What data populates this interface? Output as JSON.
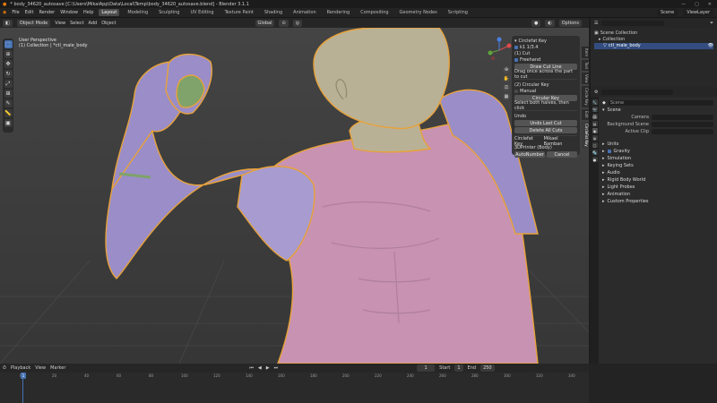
{
  "window": {
    "title": "* body_34620_autosave [C:\\Users\\MikaiApp\\Data\\Local\\Temp\\body_34620_autosave.blend] - Blender 3.1.1",
    "min": "—",
    "max": "▢",
    "close": "✕"
  },
  "menus": [
    "File",
    "Edit",
    "Render",
    "Window",
    "Help"
  ],
  "workspaces": [
    "Layout",
    "Modeling",
    "Sculpting",
    "UV Editing",
    "Texture Paint",
    "Shading",
    "Animation",
    "Rendering",
    "Compositing",
    "Geometry Nodes",
    "Scripting"
  ],
  "active_workspace": "Layout",
  "scene": {
    "label": "Scene",
    "view_layer": "ViewLayer"
  },
  "viewport_header": {
    "mode": "Object Mode",
    "menus": [
      "View",
      "Select",
      "Add",
      "Object"
    ],
    "orientation": "Global",
    "options": "Options"
  },
  "viewport_info": {
    "line1": "User Perspective",
    "line2": "(1) Collection | *ctl_male_body"
  },
  "npanel": {
    "title": "Circlefat Key",
    "k1": "k1 1/3.4",
    "cut_label": "(1) Cut",
    "freehand": "Freehand",
    "draw_btn": "Draw Cut Line",
    "draw_hint": "Drag once across the part to cut",
    "circular_label": "(2) Circular Key",
    "manual": "Manual",
    "circular_btn": "Circular Key",
    "circular_hint": "Select both halves, then click",
    "undo_label": "Undo",
    "undo_btn": "Undo Last Cut",
    "delete_btn": "Delete All Cuts",
    "k2_left": "Circlefat Key",
    "k2_right": "Mikael Bamban",
    "printer": "3DPrinter (Body)",
    "mesh_btn": "AutoNumber",
    "cancel_btn": "Cancel"
  },
  "vtabs": [
    "Item",
    "Tool",
    "View",
    "Circle Key",
    "Edit",
    "CircleFat Key"
  ],
  "outliner": {
    "search": "",
    "rows": [
      {
        "label": "Scene Collection",
        "icon": "▣"
      },
      {
        "label": "Collection",
        "icon": "▸"
      },
      {
        "label": "ctl_male_body",
        "icon": "▽"
      }
    ]
  },
  "properties": {
    "scene_name": "Scene",
    "section_scene": "Scene",
    "camera_lbl": "Camera",
    "camera_val": "",
    "bg_lbl": "Background Scene",
    "bg_val": "",
    "clip_lbl": "Active Clip",
    "clip_val": "",
    "sections": [
      "Units",
      "Gravity",
      "Simulation",
      "Keying Sets",
      "Audio",
      "Rigid Body World",
      "Light Probes",
      "Animation",
      "Custom Properties"
    ]
  },
  "timeline": {
    "menus": [
      "Playback",
      "View",
      "Marker"
    ],
    "frame": "1",
    "start_lbl": "Start",
    "start": "1",
    "end_lbl": "End",
    "end": "250",
    "ticks": [
      "0",
      "20",
      "40",
      "60",
      "80",
      "100",
      "120",
      "140",
      "160",
      "180",
      "200",
      "220",
      "240",
      "260",
      "280",
      "300",
      "320",
      "340"
    ]
  },
  "colors": {
    "accent": "#4772b3",
    "skin": "#b9b196",
    "pink": "#c892b2",
    "lavender": "#9a8dc8",
    "green": "#7fa36a",
    "outline": "#e8a23a"
  }
}
